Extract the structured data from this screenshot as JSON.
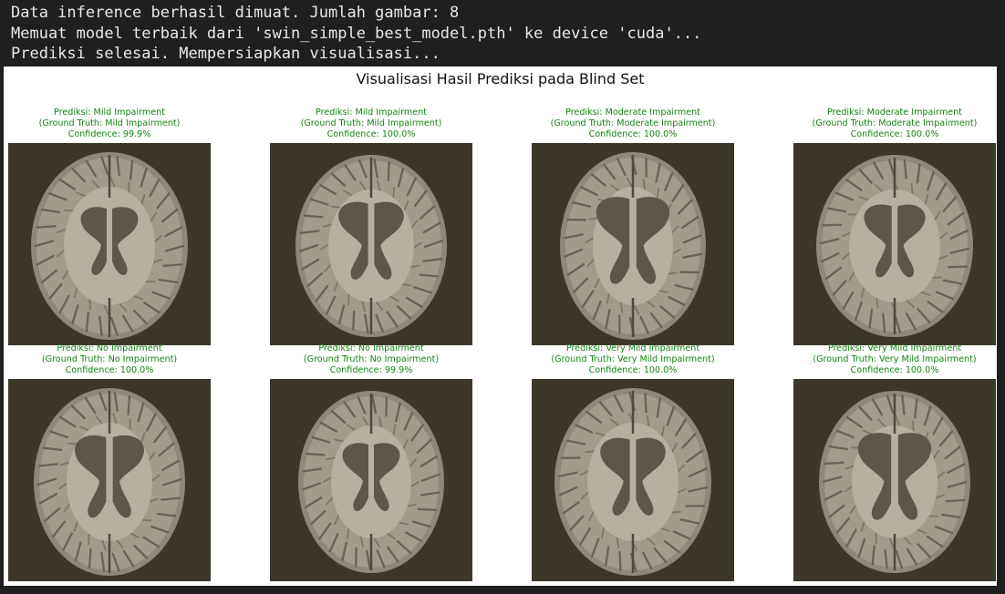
{
  "console": {
    "lines": [
      "Data inference berhasil dimuat. Jumlah gambar: 8",
      "Memuat model terbaik dari 'swin_simple_best_model.pth' ke device 'cuda'...",
      "Prediksi selesai. Mempersiapkan visualisasi..."
    ]
  },
  "figure": {
    "title": "Visualisasi Hasil Prediksi pada Blind Set",
    "caption_color": "#168216",
    "image_background": "#3d3729",
    "panels": [
      {
        "prediction": "Prediksi: Mild Impairment",
        "ground_truth": "(Ground Truth: Mild Impairment)",
        "confidence": "Confidence: 99.9%"
      },
      {
        "prediction": "Prediksi: Mild Impairment",
        "ground_truth": "(Ground Truth: Mild Impairment)",
        "confidence": "Confidence: 100.0%"
      },
      {
        "prediction": "Prediksi: Moderate Impairment",
        "ground_truth": "(Ground Truth: Moderate Impairment)",
        "confidence": "Confidence: 100.0%"
      },
      {
        "prediction": "Prediksi: Moderate Impairment",
        "ground_truth": "(Ground Truth: Moderate Impairment)",
        "confidence": "Confidence: 100.0%"
      },
      {
        "prediction": "Prediksi: No Impairment",
        "ground_truth": "(Ground Truth: No Impairment)",
        "confidence": "Confidence: 100.0%"
      },
      {
        "prediction": "Prediksi: No Impairment",
        "ground_truth": "(Ground Truth: No Impairment)",
        "confidence": "Confidence: 99.9%"
      },
      {
        "prediction": "Prediksi: Very Mild Impairment",
        "ground_truth": "(Ground Truth: Very Mild Impairment)",
        "confidence": "Confidence: 100.0%"
      },
      {
        "prediction": "Prediksi: Very Mild Impairment",
        "ground_truth": "(Ground Truth: Very Mild Impairment)",
        "confidence": "Confidence: 100.0%"
      }
    ]
  }
}
